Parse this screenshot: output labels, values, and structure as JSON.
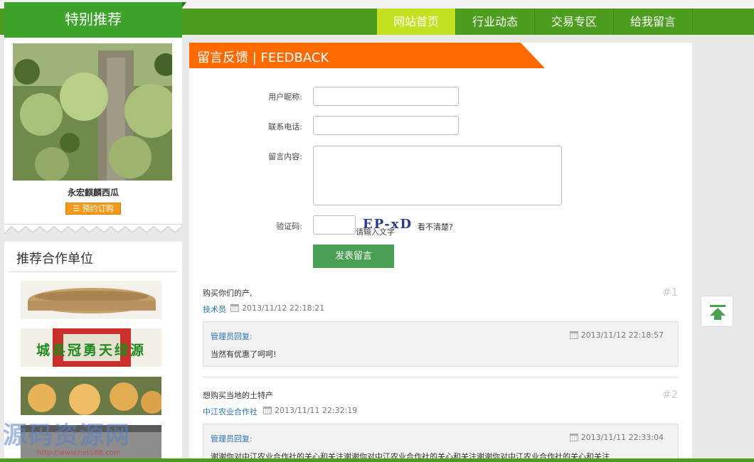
{
  "nav": {
    "items": [
      {
        "label": "网站首页",
        "active": true
      },
      {
        "label": "行业动态",
        "active": false
      },
      {
        "label": "交易专区",
        "active": false
      },
      {
        "label": "给我留言",
        "active": false
      }
    ]
  },
  "special": {
    "title": "特别推荐",
    "product_name": "永宏麒麟西瓜",
    "order_label": "预约订购"
  },
  "partners": {
    "title": "推荐合作单位",
    "banner_text": "城县冠勇天绿源"
  },
  "feedback": {
    "title": "留言反馈 | FEEDBACK",
    "nickname_label": "用户昵称:",
    "phone_label": "联系电话:",
    "content_label": "留言内容:",
    "captcha_label": "验证码:",
    "captcha_text": "EP-xD",
    "captcha_hint": "请输入文字",
    "unclear_label": "看不清楚?",
    "submit_label": "发表留言"
  },
  "messages": [
    {
      "text": "购买你们的产,",
      "author": "技术员",
      "time": "2013/11/12 22:18:21",
      "num": "#1",
      "reply_label": "管理员回复:",
      "reply_time": "2013/11/12 22:18:57",
      "reply_text": "当然有优惠了呵呵!"
    },
    {
      "text": "想购买当地的土特产",
      "author": "中江农业合作社",
      "time": "2013/11/11 22:32:19",
      "num": "#2",
      "reply_label": "管理员回复:",
      "reply_time": "2013/11/11 22:33:04",
      "reply_text": "谢谢你对中江农业合作社的关心和关注谢谢你对中江农业合作社的关心和关注谢谢你对中江农业合作社的关心和关注"
    }
  ],
  "watermark": {
    "text": "源码资源网",
    "url": "http://www.net188.com"
  },
  "colors": {
    "nav_green": "#4d9e1f",
    "nav_active": "#c4e021",
    "feedback_orange": "#ff6a00",
    "button_green": "#4aa052",
    "link_blue": "#2a73b8"
  }
}
